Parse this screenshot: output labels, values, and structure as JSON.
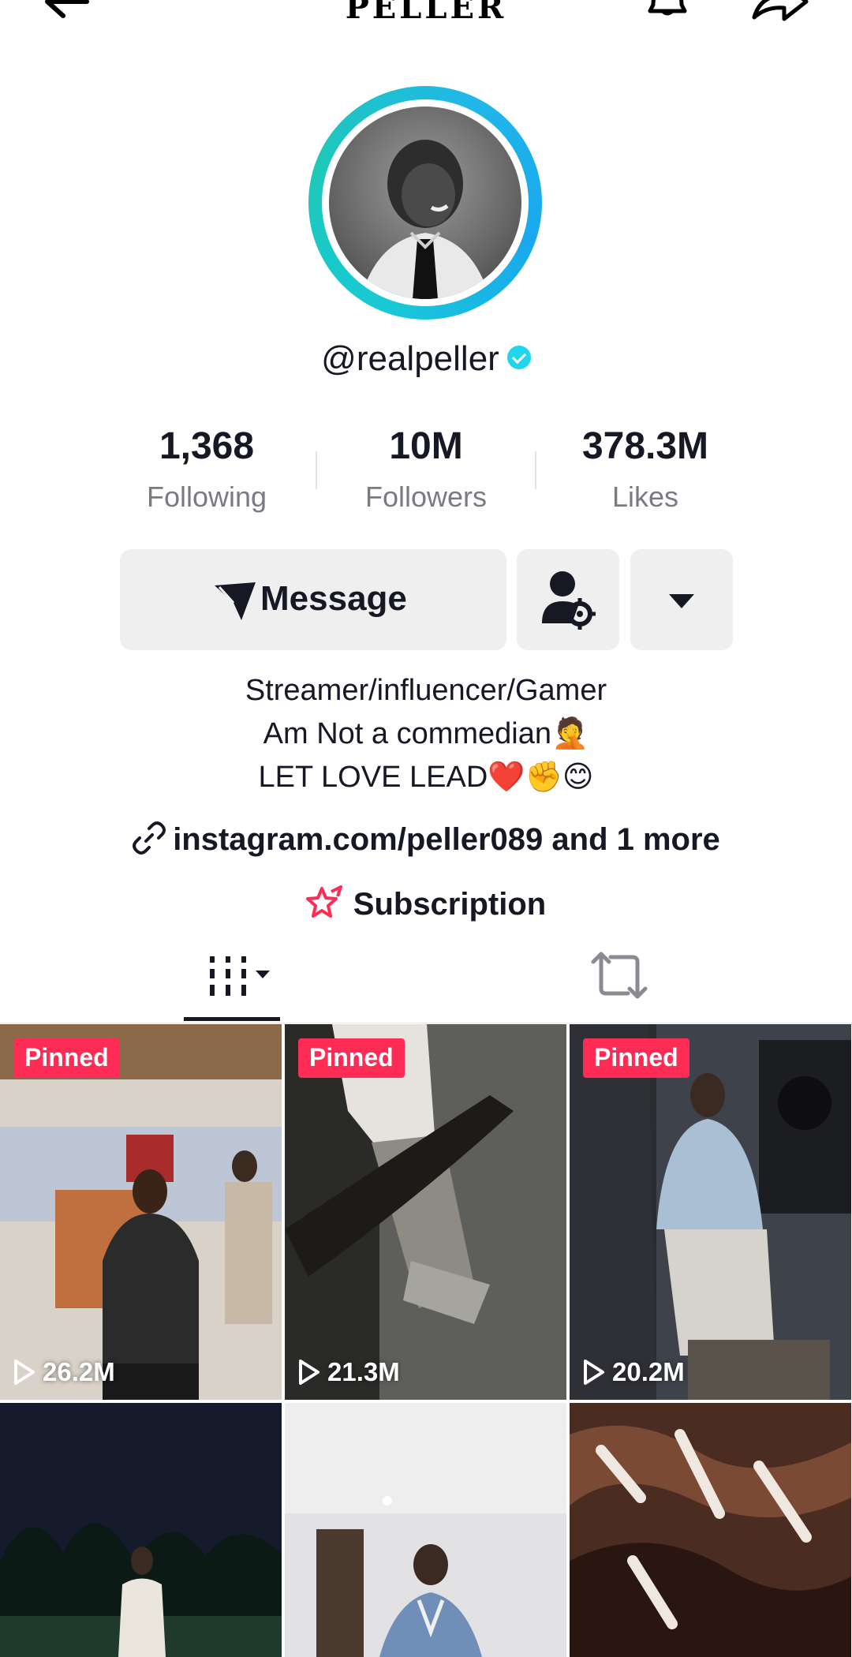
{
  "header": {
    "title": "PELLER"
  },
  "profile": {
    "username": "@realpeller",
    "verified": true,
    "ring_color": "#20d5ec"
  },
  "stats": [
    {
      "value": "1,368",
      "label": "Following"
    },
    {
      "value": "10M",
      "label": "Followers"
    },
    {
      "value": "378.3M",
      "label": "Likes"
    }
  ],
  "actions": {
    "message_label": "Message",
    "add_friend_icon": "user-gear-icon",
    "more_icon": "caret-down-icon"
  },
  "bio": {
    "line1": "Streamer/influencer/Gamer",
    "line2": "Am Not a commedian🤦",
    "line3": "LET LOVE LEAD❤️✊😊"
  },
  "link": {
    "text": "instagram.com/peller089 and 1 more"
  },
  "subscription": {
    "text": "Subscription"
  },
  "tabs": [
    {
      "icon": "grid-icon",
      "active": true
    },
    {
      "icon": "repost-icon",
      "active": false
    }
  ],
  "videos": [
    {
      "pinned": "Pinned",
      "views": "26.2M",
      "bg": "#c9b39a"
    },
    {
      "pinned": "Pinned",
      "views": "21.3M",
      "bg": "#6b6b68"
    },
    {
      "pinned": "Pinned",
      "views": "20.2M",
      "bg": "#4b4f57"
    },
    {
      "pinned": "",
      "views": "",
      "bg": "#1d2436"
    },
    {
      "pinned": "",
      "views": "",
      "bg": "#d9d9db"
    },
    {
      "pinned": "",
      "views": "",
      "bg": "#5e3b2d"
    }
  ],
  "colors": {
    "accent": "#fe2c55",
    "verified": "#20d5ec",
    "text": "#161823",
    "muted": "#7a7b82"
  }
}
